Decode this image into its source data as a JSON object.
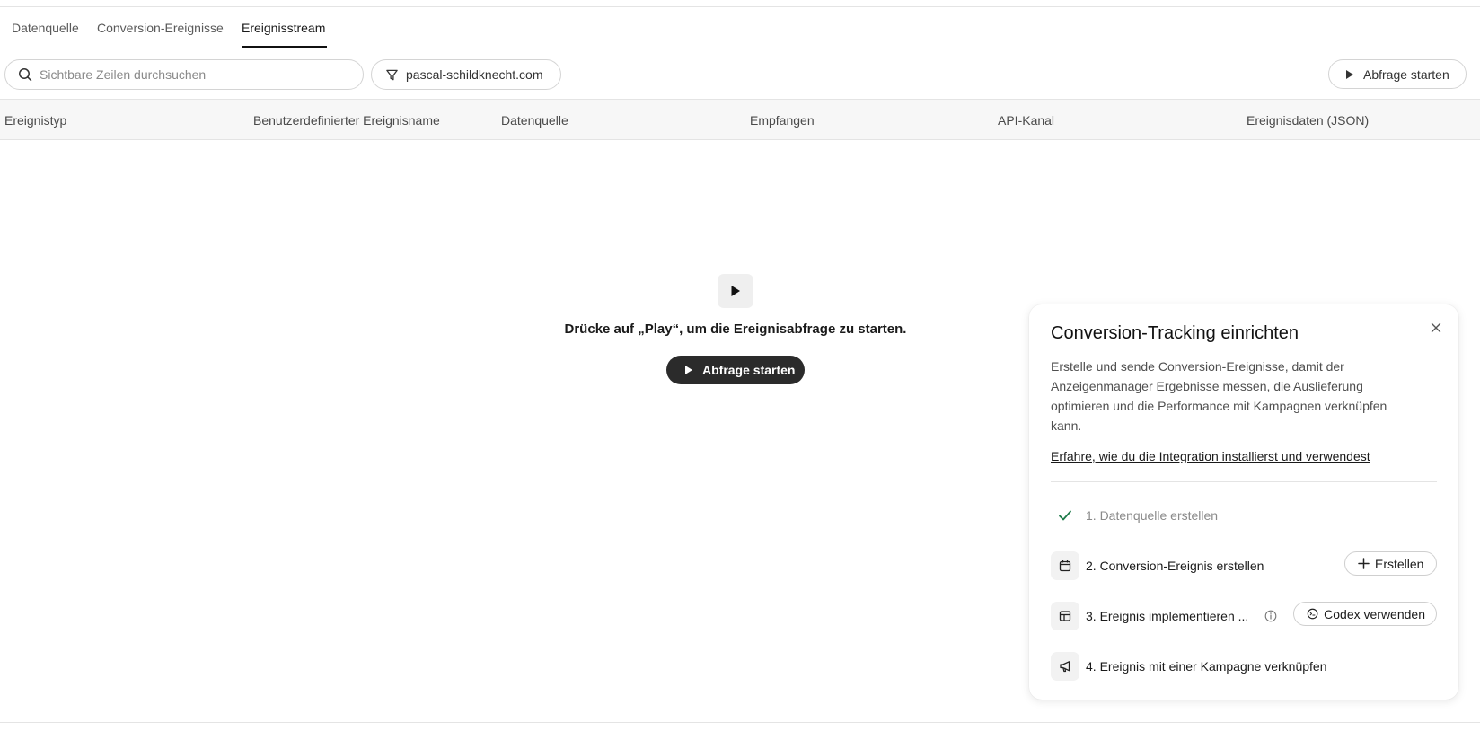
{
  "tabs": [
    {
      "label": "Datenquelle",
      "active": false
    },
    {
      "label": "Conversion-Ereignisse",
      "active": false
    },
    {
      "label": "Ereignisstream",
      "active": true
    }
  ],
  "toolbar": {
    "search_placeholder": "Sichtbare Zeilen durchsuchen",
    "filter_label": "pascal-schildknecht.com",
    "run_label": "Abfrage starten"
  },
  "table": {
    "columns": [
      "Ereignistyp",
      "Benutzerdefinierter Ereignisname",
      "Datenquelle",
      "Empfangen",
      "API-Kanal",
      "Ereignisdaten (JSON)"
    ]
  },
  "empty_state": {
    "message": "Drücke auf „Play“, um die Ereignisabfrage zu starten.",
    "button_label": "Abfrage starten"
  },
  "setup_card": {
    "title": "Conversion-Tracking einrichten",
    "description": "Erstelle und sende Conversion-Ereignisse, damit der Anzeigenmanager Ergebnisse messen, die Auslieferung optimieren und die Performance mit Kampagnen verknüpfen kann.",
    "link": "Erfahre, wie du die Integration installierst und verwendest",
    "steps": [
      {
        "label": "1. Datenquelle erstellen",
        "done": true,
        "icon": "check-icon"
      },
      {
        "label": "2. Conversion-Ereignis erstellen",
        "done": false,
        "icon": "calendar-icon",
        "button": "Erstellen"
      },
      {
        "label": "3. Ereignis implementieren ...",
        "done": false,
        "icon": "layout-icon",
        "button": "Codex verwenden"
      },
      {
        "label": "4. Ereignis mit einer Kampagne verknüpfen",
        "done": false,
        "icon": "megaphone-icon"
      }
    ]
  },
  "colors": {
    "accent_dark": "#2b2b2b",
    "check_green": "#1e7b4a",
    "border": "#e4e4e4"
  }
}
